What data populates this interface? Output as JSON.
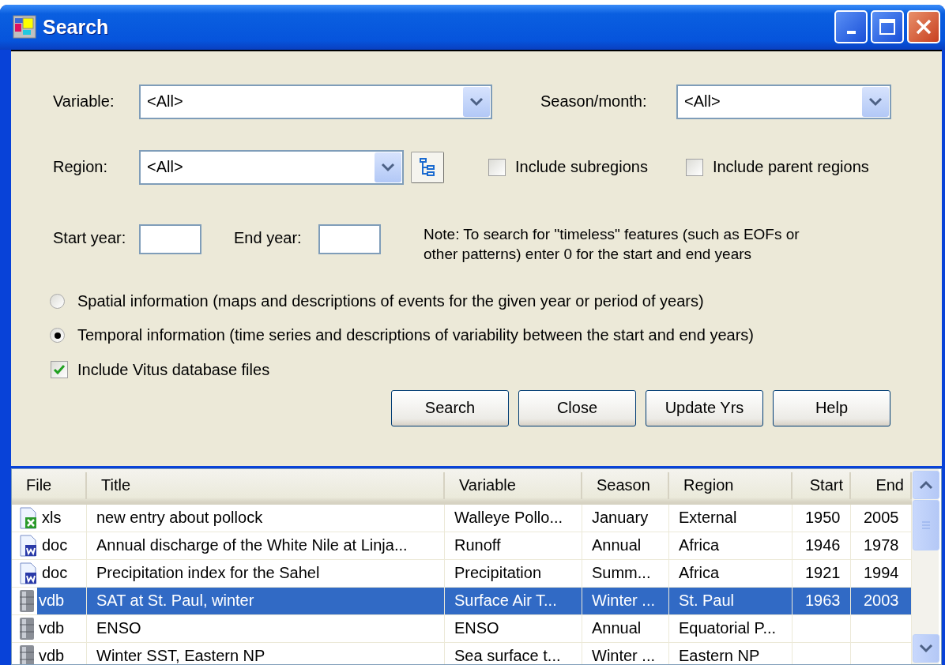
{
  "window": {
    "title": "Search"
  },
  "form": {
    "variable": {
      "label": "Variable:",
      "value": "<All>"
    },
    "season": {
      "label": "Season/month:",
      "value": "<All>"
    },
    "region": {
      "label": "Region:",
      "value": "<All>"
    },
    "region_options": [
      {
        "label": "Include subregions",
        "checked": false
      },
      {
        "label": "Include parent regions",
        "checked": false
      }
    ],
    "start_year": {
      "label": "Start year:"
    },
    "end_year": {
      "label": "End year:"
    },
    "note": "Note: To search for \"timeless\" features (such as EOFs or other patterns) enter 0 for the start and end years",
    "modes": [
      {
        "label": "Spatial information (maps and descriptions of events for the given year or period of years)",
        "selected": false
      },
      {
        "label": "Temporal information (time series and descriptions of variability between the start and end years)",
        "selected": true
      }
    ],
    "include_vitus": {
      "label": "Include Vitus database files",
      "checked": true
    },
    "buttons": [
      "Search",
      "Close",
      "Update Yrs",
      "Help"
    ]
  },
  "results": {
    "columns": [
      "File",
      "Title",
      "Variable",
      "Season",
      "Region",
      "Start",
      "End"
    ],
    "rows": [
      {
        "kind": "spreadsheet",
        "selected": false,
        "cells": [
          "xls",
          "new entry about pollock",
          "Walleye Pollo...",
          "January",
          "External",
          "1950",
          "2005"
        ]
      },
      {
        "kind": "document",
        "selected": false,
        "cells": [
          "doc",
          "Annual discharge of the White Nile at Linja...",
          "Runoff",
          "Annual",
          "Africa",
          "1946",
          "1978"
        ]
      },
      {
        "kind": "document",
        "selected": false,
        "cells": [
          "doc",
          "Precipitation index for the Sahel",
          "Precipitation",
          "Summ...",
          "Africa",
          "1921",
          "1994"
        ]
      },
      {
        "kind": "database",
        "selected": true,
        "cells": [
          "vdb",
          "SAT at St. Paul, winter",
          "Surface Air T...",
          "Winter ...",
          "St. Paul",
          "1963",
          "2003"
        ]
      },
      {
        "kind": "database",
        "selected": false,
        "cells": [
          "vdb",
          "ENSO",
          "ENSO",
          "Annual",
          "Equatorial P...",
          "",
          ""
        ]
      },
      {
        "kind": "database",
        "selected": false,
        "cells": [
          "vdb",
          "Winter SST, Eastern NP",
          "Sea surface t...",
          "Winter ...",
          "Eastern NP",
          "",
          ""
        ]
      }
    ]
  }
}
